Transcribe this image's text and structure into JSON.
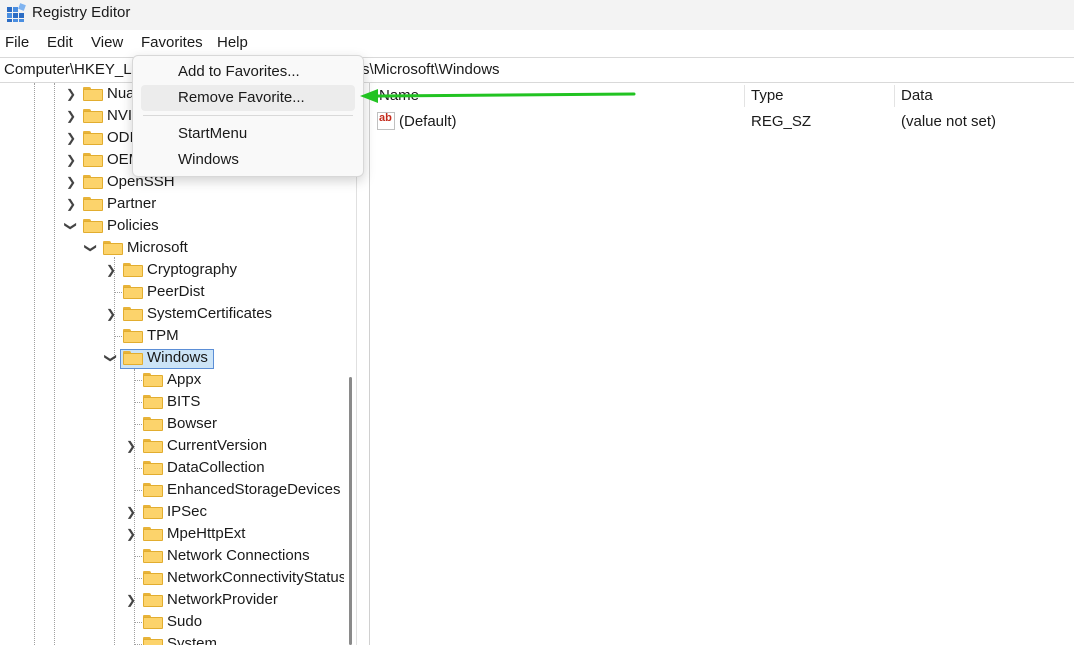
{
  "window": {
    "title": "Registry Editor"
  },
  "menubar": [
    {
      "label": "File"
    },
    {
      "label": "Edit"
    },
    {
      "label": "View"
    },
    {
      "label": "Favorites"
    },
    {
      "label": "Help"
    }
  ],
  "address": {
    "left": "Computer\\HKEY_LO",
    "right": "s\\Microsoft\\Windows"
  },
  "favorites_menu": {
    "add": "Add to Favorites...",
    "remove": "Remove Favorite...",
    "favorites": [
      "StartMenu",
      "Windows"
    ]
  },
  "tree": {
    "top_items": [
      "Nua",
      "NVI",
      "ODI",
      "OEM",
      "OpenSSH",
      "Partner",
      "Policies"
    ],
    "microsoft": "Microsoft",
    "microsoft_children": [
      "Cryptography",
      "PeerDist",
      "SystemCertificates",
      "TPM",
      "Windows"
    ],
    "windows_children": [
      "Appx",
      "BITS",
      "Bowser",
      "CurrentVersion",
      "DataCollection",
      "EnhancedStorageDevices",
      "IPSec",
      "MpeHttpExt",
      "Network Connections",
      "NetworkConnectivityStatus",
      "NetworkProvider",
      "Sudo",
      "System"
    ],
    "selected": "Windows"
  },
  "list": {
    "headers": {
      "name": "Name",
      "type": "Type",
      "data": "Data"
    },
    "rows": [
      {
        "name": "(Default)",
        "type": "REG_SZ",
        "data": "(value not set)"
      }
    ]
  },
  "colors": {
    "highlight_arrow": "#22c322",
    "selection": "#cce4f7",
    "folder": "#fcd36b"
  },
  "icons": {
    "app": "registry-icon",
    "value": "string-value-icon",
    "folder": "folder-icon"
  }
}
